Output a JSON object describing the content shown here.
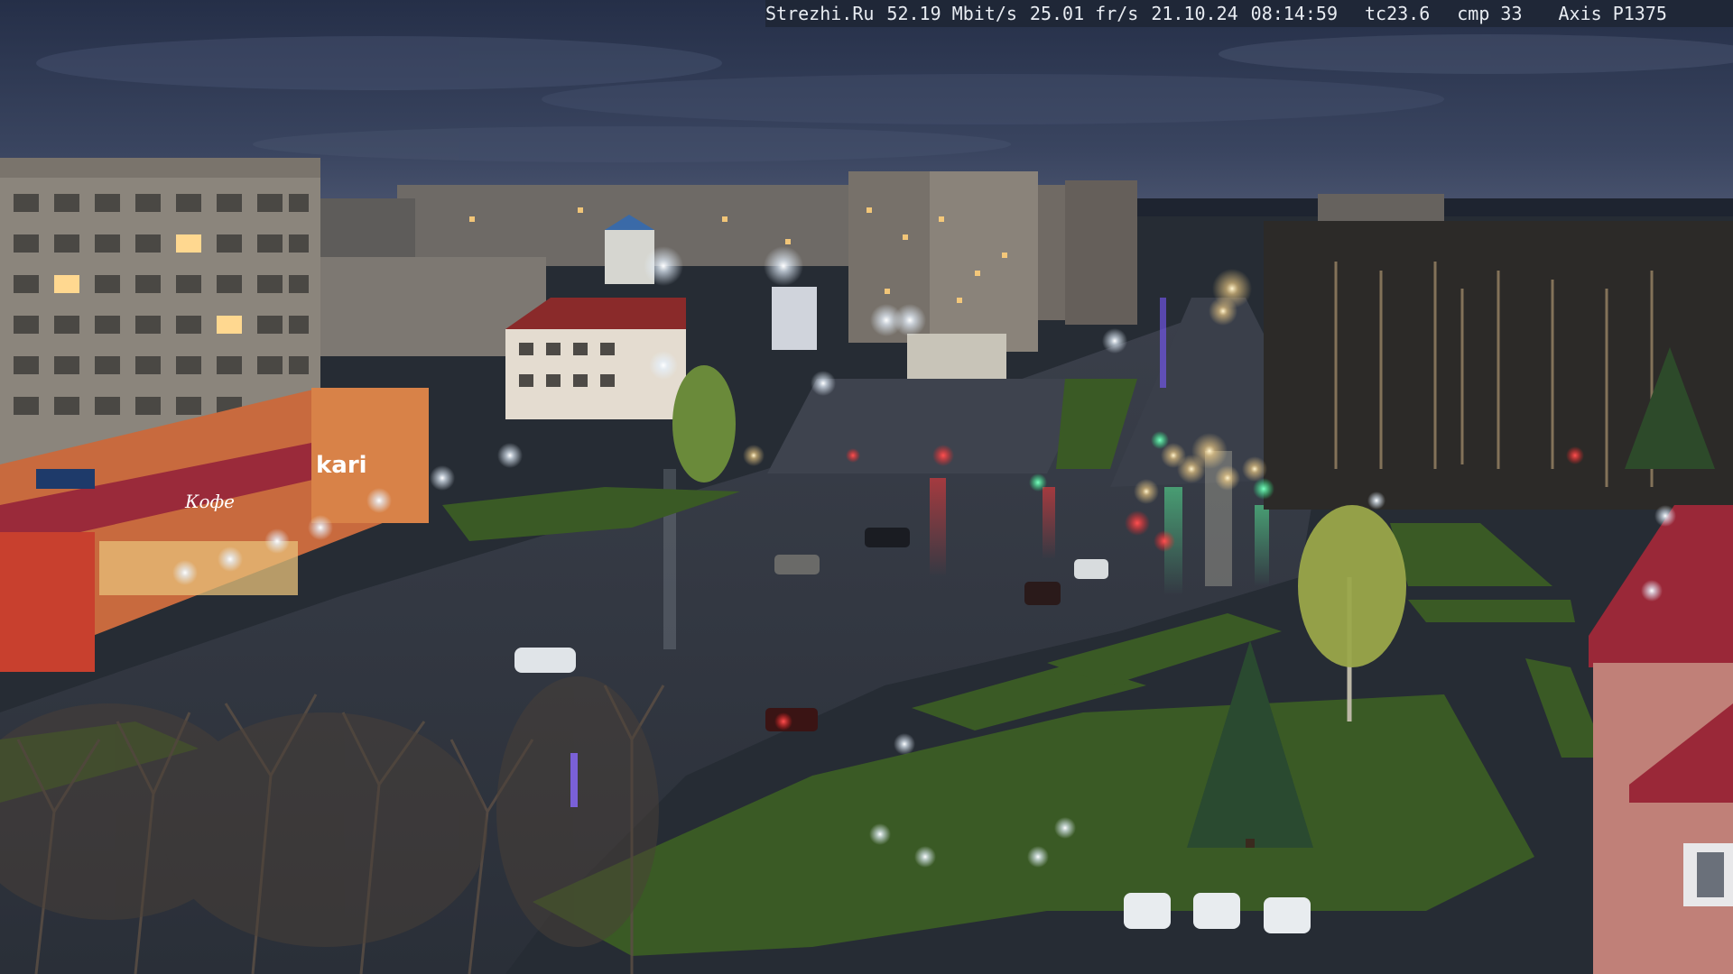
{
  "overlay": {
    "site": "Strezhi.Ru",
    "bitrate": "52.19 Mbit/s",
    "framerate": "25.01 fr/s",
    "date": "21.10.24",
    "time": "08:14:59",
    "tc": "tc23.6",
    "cmp": "cmp 33",
    "camera": "Axis P1375"
  },
  "signage": {
    "store_sign": "kari",
    "store_sign_secondary": "Кофе"
  },
  "scene_colors": {
    "sky_top": "#2a3550",
    "sky_horizon": "#46506a",
    "road": "#2f3540",
    "grass": "#2f4a22",
    "streetlight": "#e8f4ff",
    "traffic_red": "#ff2a2a",
    "traffic_green": "#2aff8a"
  }
}
